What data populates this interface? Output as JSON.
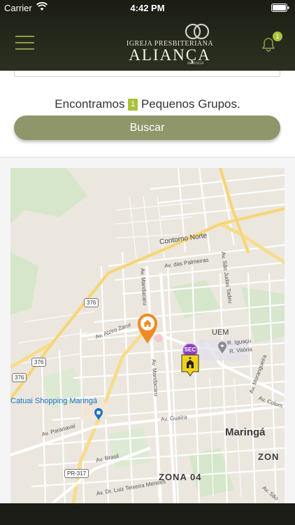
{
  "status_bar": {
    "carrier": "Carrier",
    "time": "4:42 PM"
  },
  "header": {
    "logo": {
      "top_line": "IGREJA PRESBITERIANA",
      "main": "ALIANÇA",
      "sub": "MARINGÁ"
    },
    "notification_count": "1",
    "accent_color": "#8b9a4b"
  },
  "search": {
    "result_prefix": "Encontramos",
    "result_count": "1",
    "result_suffix": "Pequenos Grupos.",
    "button_label": "Buscar",
    "button_color": "#8f966a"
  },
  "map": {
    "street_labels": {
      "contorno_norte": "Contorno Norte",
      "av_palmeiras": "Av. das Palmeiras",
      "av_sao_judas": "Av. São Judas Tadeu",
      "av_mandacaru_1": "Av. Mandacaru",
      "av_mandacaru_2": "Av. Mandacaru",
      "av_atiro_zarur": "Av. Alziro Zarur",
      "r_iguacu": "R. Iguaçu",
      "r_vitoria": "R. Vitória",
      "av_morangueira": "Av. Morangueira",
      "av_colombo": "Av. Colom",
      "av_paranavai": "Av. Paranavaí",
      "av_guaira": "Av. Guaíra",
      "av_brasil": "Av. Brasil",
      "av_luiz_teixeira": "Av. Dr. Luiz Teixeira Mendes",
      "av_sao": "Av. São"
    },
    "place_labels": {
      "uem": "UEM",
      "catuai": "Catuai Shopping Maringá",
      "maringa": "Maringá",
      "zona04": "ZONA 04",
      "zona_right": "ZON"
    },
    "road_shields": {
      "r376_a": "376",
      "r376_b": "376",
      "r376_c": "376",
      "pr317": "PR-317"
    },
    "markers": {
      "house_color": "#f08a24",
      "church_label": "SEC",
      "church_color": "#f0d21a",
      "church_badge_color": "#8e3fc1"
    }
  }
}
